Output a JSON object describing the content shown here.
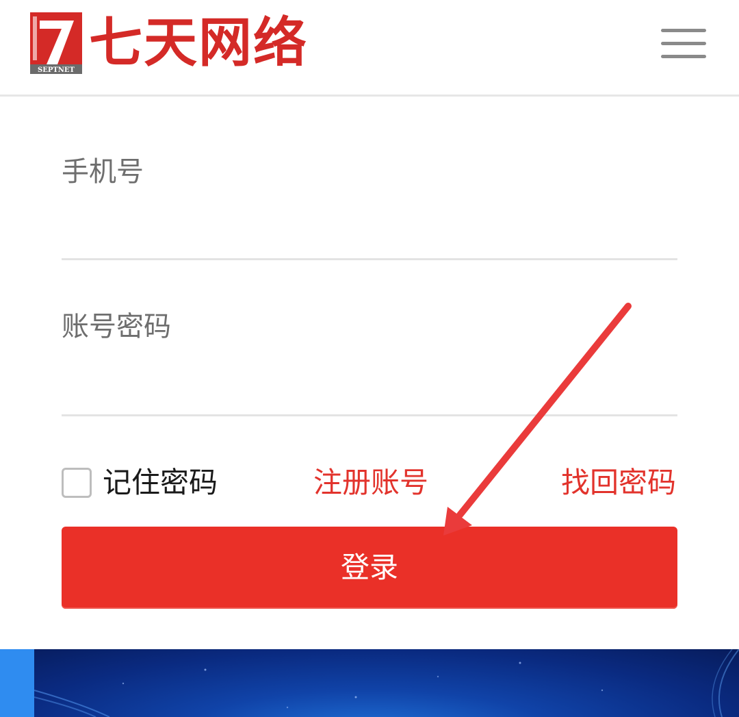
{
  "header": {
    "logo_text": "七天网络",
    "logo_sub": "SEPTNET",
    "menu_icon": "hamburger-menu-icon"
  },
  "form": {
    "phone": {
      "placeholder": "手机号",
      "value": ""
    },
    "password": {
      "placeholder": "账号密码",
      "value": ""
    },
    "remember_label": "记住密码",
    "remember_checked": false,
    "register_label": "注册账号",
    "forgot_label": "找回密码",
    "login_label": "登录"
  },
  "colors": {
    "brand_red": "#d42a27",
    "link_red": "#e2332c",
    "button_red": "#ea3028",
    "annotation_red": "#ea3b3b",
    "banner_blue": "#0a2a80"
  }
}
